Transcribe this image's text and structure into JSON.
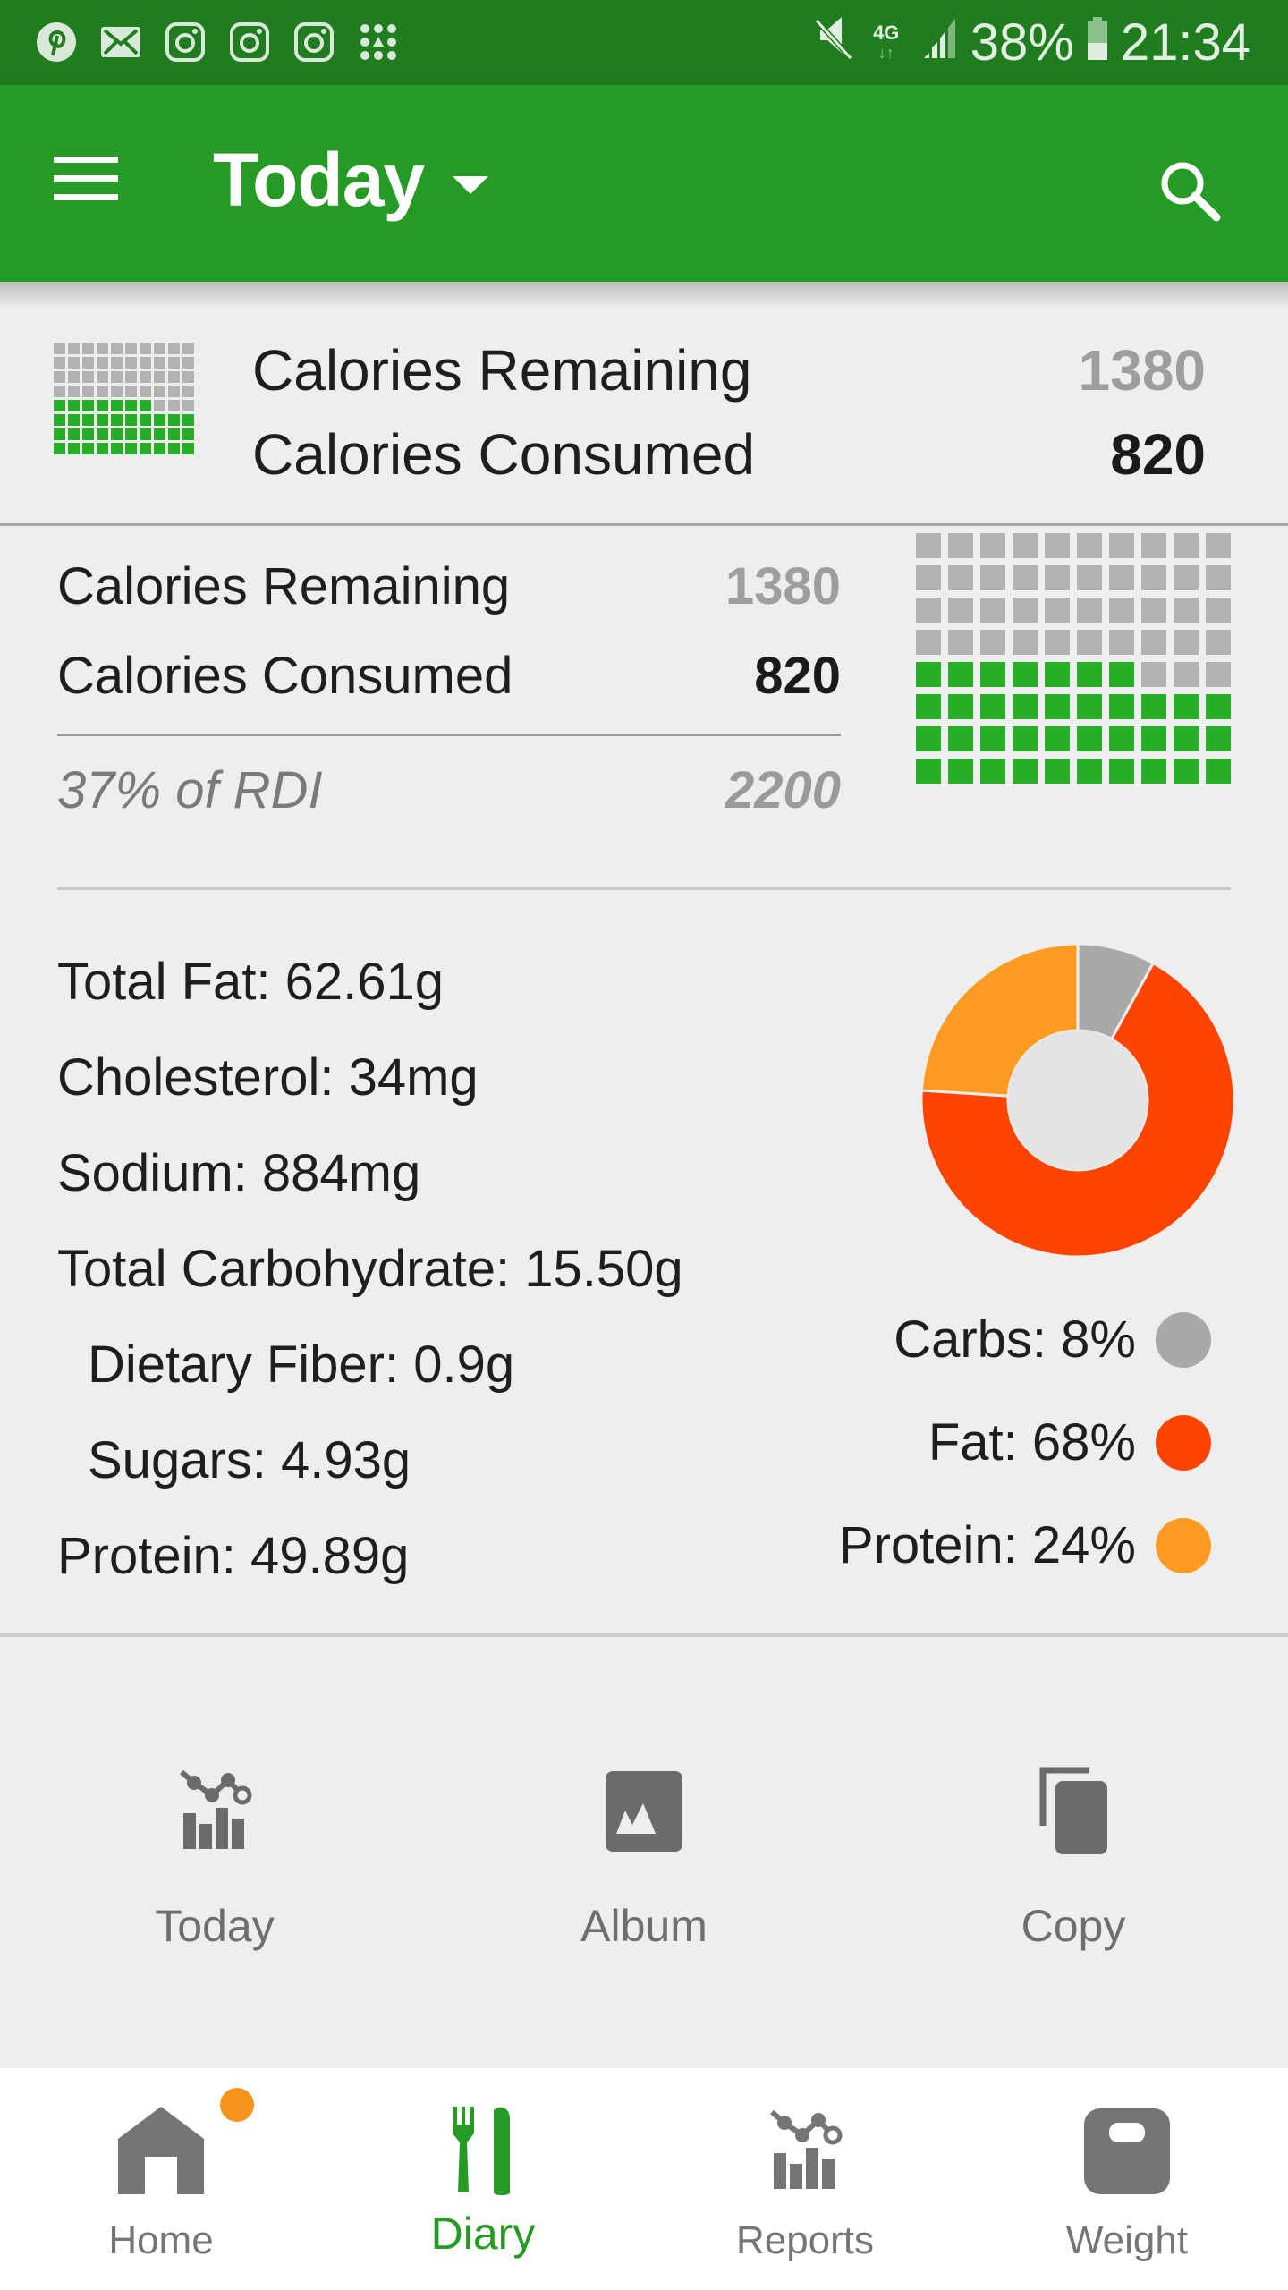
{
  "status_bar": {
    "notification_icons": [
      "pinterest-icon",
      "mail-icon",
      "instagram-icon",
      "instagram-icon",
      "instagram-icon",
      "apps-grid-icon"
    ],
    "network": "4G",
    "battery": "38%",
    "time": "21:34"
  },
  "app_bar": {
    "title": "Today",
    "menu_icon": "hamburger-menu-icon",
    "search_icon": "search-icon"
  },
  "summary_header": {
    "remaining_label": "Calories Remaining",
    "remaining_value": "1380",
    "consumed_label": "Calories Consumed",
    "consumed_value": "820"
  },
  "calories": {
    "remaining_label": "Calories Remaining",
    "remaining_value": "1380",
    "consumed_label": "Calories Consumed",
    "consumed_value": "820",
    "rdi_label": "37% of RDI",
    "rdi_value": "2200",
    "grid_total_cells": 80,
    "grid_filled_cells": 37,
    "grid_filled_fraction": 0.37
  },
  "nutrients": [
    {
      "text": "Total Fat: 62.61g",
      "indent": false
    },
    {
      "text": "Cholesterol: 34mg",
      "indent": false
    },
    {
      "text": "Sodium: 884mg",
      "indent": false
    },
    {
      "text": "Total Carbohydrate: 15.50g",
      "indent": false
    },
    {
      "text": "Dietary Fiber: 0.9g",
      "indent": true
    },
    {
      "text": "Sugars: 4.93g",
      "indent": true
    },
    {
      "text": "Protein: 49.89g",
      "indent": false
    }
  ],
  "chart_data": {
    "type": "pie",
    "title": "",
    "donut": true,
    "categories": [
      "Carbs",
      "Fat",
      "Protein"
    ],
    "values": [
      8,
      68,
      24
    ],
    "colors": [
      "#a9a9a9",
      "#ff4400",
      "#ff9a22"
    ],
    "legend_labels": [
      "Carbs: 8%",
      "Fat: 68%",
      "Protein: 24%"
    ],
    "legend_position": "bottom-right",
    "start": "top, clockwise"
  },
  "actions": [
    {
      "label": "Today",
      "icon": "chart-report-icon"
    },
    {
      "label": "Album",
      "icon": "photo-album-icon"
    },
    {
      "label": "Copy",
      "icon": "copy-icon"
    }
  ],
  "bottom_nav": [
    {
      "label": "Home",
      "icon": "home-icon",
      "badge": true,
      "active": false
    },
    {
      "label": "Diary",
      "icon": "fork-knife-icon",
      "badge": false,
      "active": true
    },
    {
      "label": "Reports",
      "icon": "chart-report-icon",
      "badge": false,
      "active": false
    },
    {
      "label": "Weight",
      "icon": "scale-icon",
      "badge": false,
      "active": false
    }
  ],
  "colors": {
    "status_bar": "#1f7d1f",
    "app_bar": "#259a25",
    "accent_green": "#27ae27",
    "grid_empty": "#b2b2b2",
    "badge_orange": "#f7941d"
  }
}
